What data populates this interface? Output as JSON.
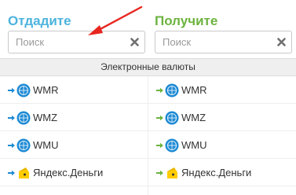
{
  "give": {
    "title": "Отдадите",
    "search_placeholder": "Поиск"
  },
  "get": {
    "title": "Получите",
    "search_placeholder": "Поиск"
  },
  "section": {
    "title": "Электронные валюты"
  },
  "currencies": [
    {
      "name": "WMR",
      "icon": "webmoney-icon"
    },
    {
      "name": "WMZ",
      "icon": "webmoney-icon"
    },
    {
      "name": "WMU",
      "icon": "webmoney-icon"
    },
    {
      "name": "Яндекс.Деньги",
      "icon": "yandex-money-icon"
    }
  ],
  "colors": {
    "give_accent": "#4cb3dd",
    "get_accent": "#6cb33f",
    "annotation_arrow": "#e8251f",
    "webmoney_blue": "#1d8ad4",
    "yandex_yellow": "#ffcc00"
  }
}
